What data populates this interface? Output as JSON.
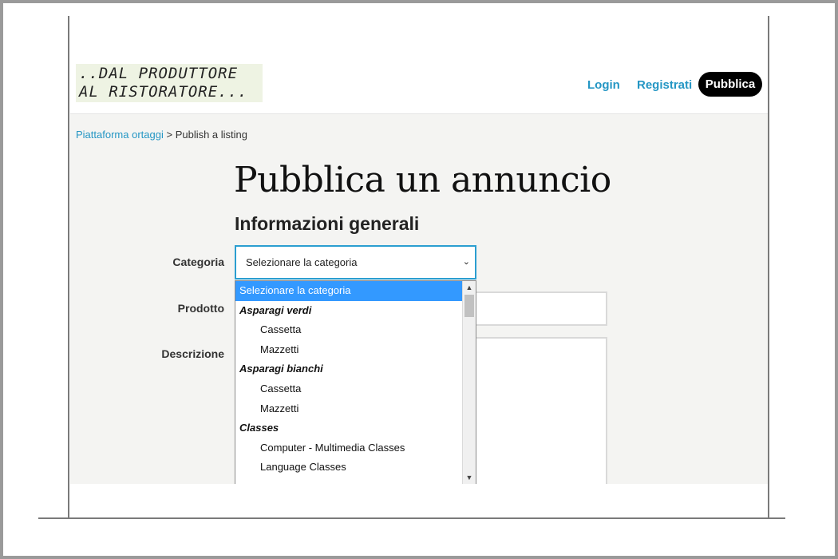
{
  "header": {
    "logo_line1": "..DAL PRODUTTORE",
    "logo_line2": "AL RISTORATORE...",
    "login_label": "Login",
    "register_label": "Registrati",
    "publish_label": "Pubblica"
  },
  "breadcrumb": {
    "home": "Piattaforma ortaggi",
    "separator": ">",
    "current": "Publish a listing"
  },
  "main": {
    "title": "Pubblica un annuncio",
    "section_title": "Informazioni generali",
    "category_label": "Categoria",
    "product_label": "Prodotto",
    "description_label": "Descrizione",
    "category_value": "Selezionare la categoria"
  },
  "dropdown": {
    "options": [
      {
        "label": "Selezionare la categoria",
        "type": "selected"
      },
      {
        "label": "Asparagi verdi",
        "type": "group"
      },
      {
        "label": "Cassetta",
        "type": "child"
      },
      {
        "label": "Mazzetti",
        "type": "child"
      },
      {
        "label": "Asparagi bianchi",
        "type": "group"
      },
      {
        "label": "Cassetta",
        "type": "child"
      },
      {
        "label": "Mazzetti",
        "type": "child"
      },
      {
        "label": "Classes",
        "type": "group"
      },
      {
        "label": "Computer - Multimedia Classes",
        "type": "child"
      },
      {
        "label": "Language Classes",
        "type": "child"
      }
    ]
  },
  "colors": {
    "accent": "#2496c4",
    "selected_option": "#3399ff",
    "publish_button": "#000000"
  }
}
